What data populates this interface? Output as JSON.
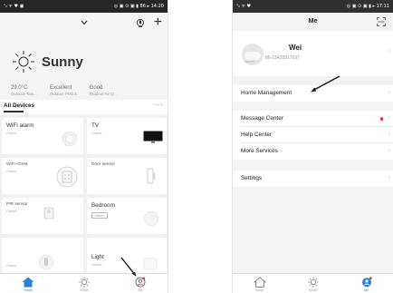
{
  "phone1": {
    "statusbar": {
      "left": "ᵒᵢₗ ᯤ ♥ ▣",
      "right": "◎ ▣ ⊙ ▣ ▮ 86 ▸ 14:20"
    },
    "weather": {
      "title": "Sunny",
      "icon": "sun-icon"
    },
    "stats": [
      {
        "value": "29.0°C",
        "label": "Outdoor Tem..."
      },
      {
        "value": "Excellent",
        "label": "Outdoor PM2.5"
      },
      {
        "value": "Good",
        "label": "Outdoor Air Q..."
      }
    ],
    "devices": {
      "title": "All Devices",
      "more": "···",
      "cards": [
        {
          "title": "WiFi alarm",
          "status": "Online"
        },
        {
          "title": "TV",
          "status": "Online"
        },
        {
          "title": "WiFi+GSM",
          "status": "Online"
        },
        {
          "title": "Door sensor",
          "status": ""
        },
        {
          "title": "PIR sensor",
          "status": "Online"
        },
        {
          "title": "Bedroom",
          "status": "Offline"
        },
        {
          "title": "",
          "status": "Online"
        },
        {
          "title": "Light",
          "status": "Online"
        }
      ]
    },
    "tabs": [
      {
        "label": "Home",
        "icon": "home-icon"
      },
      {
        "label": "Smart",
        "icon": "sun-outline-icon"
      },
      {
        "label": "Me",
        "icon": "person-icon"
      }
    ],
    "accent": "#2f7fd6"
  },
  "phone2": {
    "statusbar": {
      "left": "ᵒᵢₗ ᯤ ♥",
      "right": "◎ ▣ ⊙ ▣ ▮ ▸ 17:11"
    },
    "title": "Me",
    "profile": {
      "name": "Wei",
      "phone": "86-13428917697",
      "avatar_text": "PHOTO"
    },
    "menu": [
      {
        "label": "Home Management"
      },
      {
        "label": "Message Center",
        "badge": true
      },
      {
        "label": "Help Center"
      },
      {
        "label": "More Services"
      },
      {
        "label": "Settings"
      }
    ],
    "tabs": [
      {
        "label": "Home",
        "icon": "home-outline-icon"
      },
      {
        "label": "Smart",
        "icon": "sun-outline-icon"
      },
      {
        "label": "Me",
        "icon": "person-active-icon"
      }
    ],
    "badge_color": "#e33333"
  }
}
